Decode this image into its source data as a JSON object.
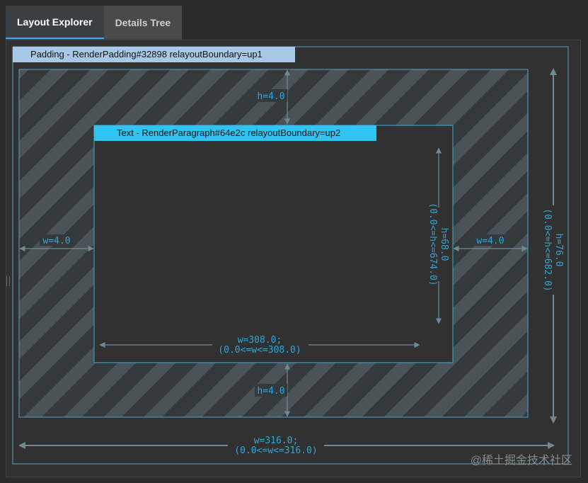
{
  "tabs": [
    {
      "label": "Layout Explorer",
      "active": true
    },
    {
      "label": "Details Tree",
      "active": false
    }
  ],
  "outer_widget": {
    "title": "Padding - RenderPadding#32898 relayoutBoundary=up1",
    "height_label": "h=76.0",
    "height_constraint": "(0.0<=h<=682.0)",
    "width_label": "w=316.0;",
    "width_constraint": "(0.0<=w<=316.0)"
  },
  "padding": {
    "top": "h=4.0",
    "bottom": "h=4.0",
    "left": "w=4.0",
    "right": "w=4.0"
  },
  "inner_widget": {
    "title": "Text - RenderParagraph#64e2c relayoutBoundary=up2",
    "height_label": "h=68.0",
    "height_constraint": "(0.0<=h<=674.0)",
    "width_label": "w=308.0;",
    "width_constraint": "(0.0<=w<=308.0)"
  },
  "watermark": "@稀土掘金技术社区",
  "colors": {
    "padding_header": "#a8c8e8",
    "text_header": "#2fc4f2",
    "label": "#2ea6d9",
    "arrow": "#6f8a94",
    "stripe": "#4a5358"
  }
}
